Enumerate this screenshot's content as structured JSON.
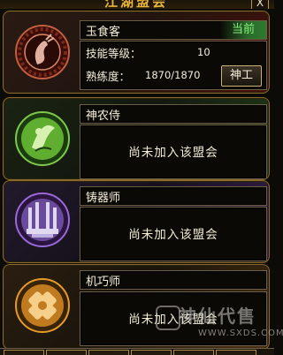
{
  "window": {
    "title": "江湖盟会",
    "close_label": "X"
  },
  "accent_colors": {
    "gold": "#e8b53a",
    "status_green": "#86f07a"
  },
  "guilds": [
    {
      "name": "玉食客",
      "status": "当前",
      "skill_level_label": "技能等级：",
      "skill_level_value": "10",
      "proficiency_label": "熟练度：",
      "proficiency_value": "1870/1870",
      "action_label": "神工",
      "emblem": "food-emblem-icon",
      "color": "#a3281c"
    },
    {
      "name": "神农侍",
      "message": "尚未加入该盟会",
      "emblem": "herb-emblem-icon",
      "color": "#6fbf3a"
    },
    {
      "name": "铸器师",
      "message": "尚未加入该盟会",
      "emblem": "forge-emblem-icon",
      "color": "#9b6ad8"
    },
    {
      "name": "机巧师",
      "message": "尚未加入该盟会",
      "emblem": "gear-emblem-icon",
      "color": "#e69a2a"
    }
  ],
  "watermark": {
    "text": "神仙代售",
    "url": "WWW.SXDS.COM"
  }
}
